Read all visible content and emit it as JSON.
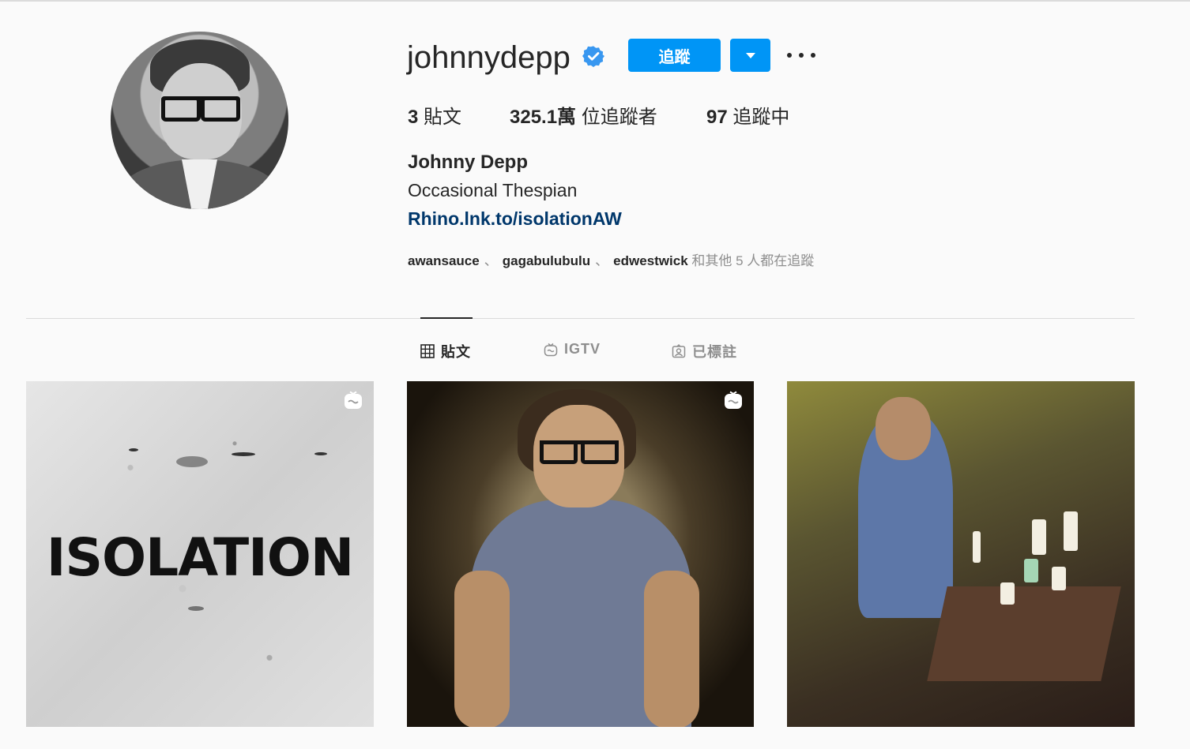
{
  "profile": {
    "username": "johnnydepp",
    "full_name": "Johnny Depp",
    "bio": "Occasional Thespian",
    "link": "Rhino.lnk.to/isolationAW",
    "verified": true
  },
  "actions": {
    "follow_label": "追蹤"
  },
  "stats": {
    "posts_count": "3",
    "posts_label": "貼文",
    "followers_count": "325.1萬",
    "followers_label": "位追蹤者",
    "following_count": "97",
    "following_label": "追蹤中"
  },
  "followed_by": {
    "users": [
      "awansauce",
      "gagabulubulu",
      "edwestwick"
    ],
    "separator": "、",
    "suffix": "和其他 5 人都在追蹤"
  },
  "tabs": [
    {
      "label": "貼文",
      "icon": "grid-icon",
      "active": true
    },
    {
      "label": "IGTV",
      "icon": "igtv-icon",
      "active": false
    },
    {
      "label": "已標註",
      "icon": "tagged-icon",
      "active": false
    }
  ],
  "posts": [
    {
      "overlay_text": "ISOLATION",
      "badge": "igtv-icon"
    },
    {
      "badge": "igtv-icon"
    },
    {}
  ],
  "colors": {
    "accent": "#0095f6",
    "link": "#00376b",
    "background": "#fafafa",
    "text": "#262626",
    "muted": "#8e8e8e"
  }
}
